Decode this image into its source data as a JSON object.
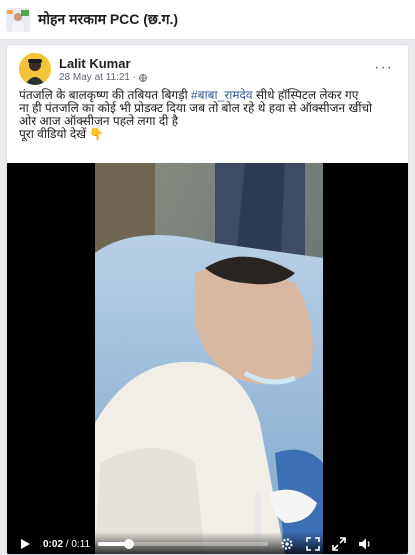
{
  "page": {
    "name": "मोहन मरकाम PCC (छ.ग.)"
  },
  "post": {
    "author": "Lalit Kumar",
    "date": "28 May at 11:21 ·",
    "text_lines": [
      [
        "पंतजलि के बालकृष्ण की तबियत बिगड़ी ",
        "#बाबा_रामदेव",
        " सीधे हॉस्पिटल लेकर गए"
      ],
      [
        "ना ही पंतजलि का कोई भी प्रोडक्ट दिया जब तो बोल रहे थे हवा से ऑक्सीजन खींचो"
      ],
      [
        "ओर आज ऑक्सीजन पहले लगा दी है"
      ],
      [
        "पूरा वीडियो देखें 👇"
      ]
    ]
  },
  "video": {
    "current_time": "0:02",
    "total_time": "/ 0:11",
    "progress_fraction": 0.18,
    "controls": [
      "play-icon",
      "settings-icon",
      "fullscreen-icon",
      "volume-icon",
      "expand-icon"
    ]
  },
  "colors": {
    "hashtag": "#385898",
    "author_avatar_bg": "#f3c43a"
  }
}
